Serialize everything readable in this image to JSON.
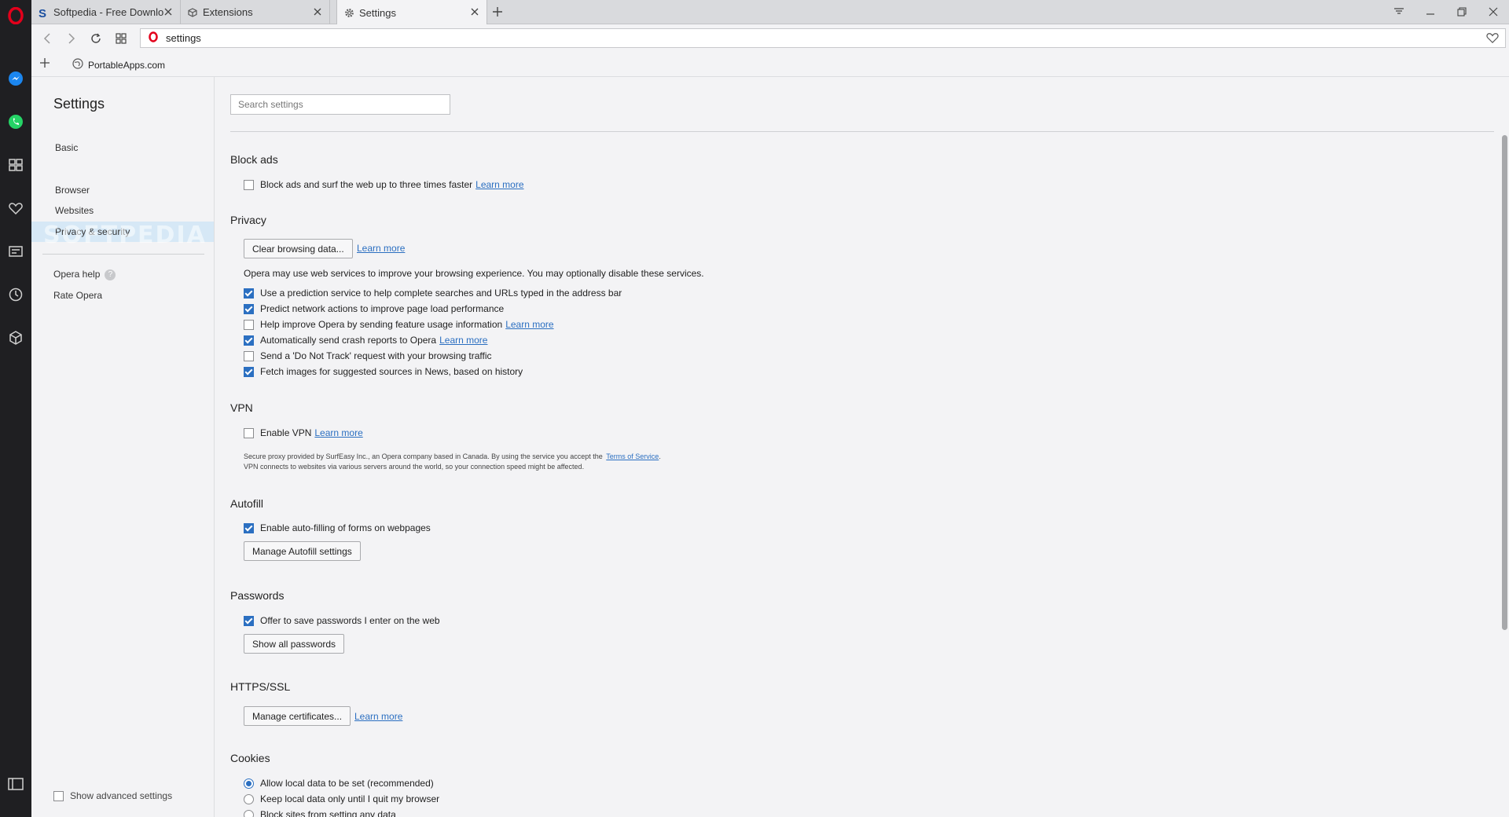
{
  "tabs": [
    {
      "title": "Softpedia - Free Downloads",
      "icon": "softpedia-s-icon",
      "active": false
    },
    {
      "title": "Extensions",
      "icon": "cube-icon",
      "active": false
    },
    {
      "title": "Settings",
      "icon": "gear-icon",
      "active": true
    }
  ],
  "address_bar": {
    "value": "settings"
  },
  "bookmarks": [
    {
      "label": "PortableApps.com",
      "icon": "globe-icon"
    }
  ],
  "watermark": "SOFTPEDIA",
  "settings_nav": {
    "title": "Settings",
    "items": [
      "Basic",
      "Browser",
      "Websites",
      "Privacy & security"
    ],
    "selected": "Privacy & security",
    "help": "Opera help",
    "rate": "Rate Opera",
    "advanced_label": "Show advanced settings",
    "advanced_checked": false
  },
  "search": {
    "placeholder": "Search settings",
    "value": ""
  },
  "link_text": "Learn more",
  "block_ads": {
    "title": "Block ads",
    "option": {
      "label": "Block ads and surf the web up to three times faster",
      "checked": false
    }
  },
  "privacy": {
    "title": "Privacy",
    "clear_button": "Clear browsing data...",
    "intro": "Opera may use web services to improve your browsing experience. You may optionally disable these services.",
    "options": [
      {
        "label": "Use a prediction service to help complete searches and URLs typed in the address bar",
        "checked": true
      },
      {
        "label": "Predict network actions to improve page load performance",
        "checked": true
      },
      {
        "label": "Help improve Opera by sending feature usage information",
        "checked": false
      },
      {
        "label": "Automatically send crash reports to Opera",
        "checked": true
      },
      {
        "label": "Send a 'Do Not Track' request with your browsing traffic",
        "checked": false
      },
      {
        "label": "Fetch images for suggested sources in News, based on history",
        "checked": true
      }
    ]
  },
  "vpn": {
    "title": "VPN",
    "option": {
      "label": "Enable VPN",
      "checked": false
    },
    "note1": "Secure proxy provided by SurfEasy Inc., an Opera company based in Canada. By using the service you accept the",
    "terms": "Terms of Service",
    "note2": "VPN connects to websites via various servers around the world, so your connection speed might be affected."
  },
  "autofill": {
    "title": "Autofill",
    "option": {
      "label": "Enable auto-filling of forms on webpages",
      "checked": true
    },
    "button": "Manage Autofill settings"
  },
  "passwords": {
    "title": "Passwords",
    "option": {
      "label": "Offer to save passwords I enter on the web",
      "checked": true
    },
    "button": "Show all passwords"
  },
  "https": {
    "title": "HTTPS/SSL",
    "button": "Manage certificates..."
  },
  "cookies": {
    "title": "Cookies",
    "options": [
      {
        "label": "Allow local data to be set (recommended)",
        "checked": true
      },
      {
        "label": "Keep local data only until I quit my browser",
        "checked": false
      },
      {
        "label": "Block sites from setting any data",
        "checked": false
      }
    ]
  },
  "colors": {
    "accent": "#2b6fc1",
    "opera_red": "#e3001b",
    "sidebar_bg": "#1f1f22",
    "selected_nav": "#d6e8f6"
  }
}
